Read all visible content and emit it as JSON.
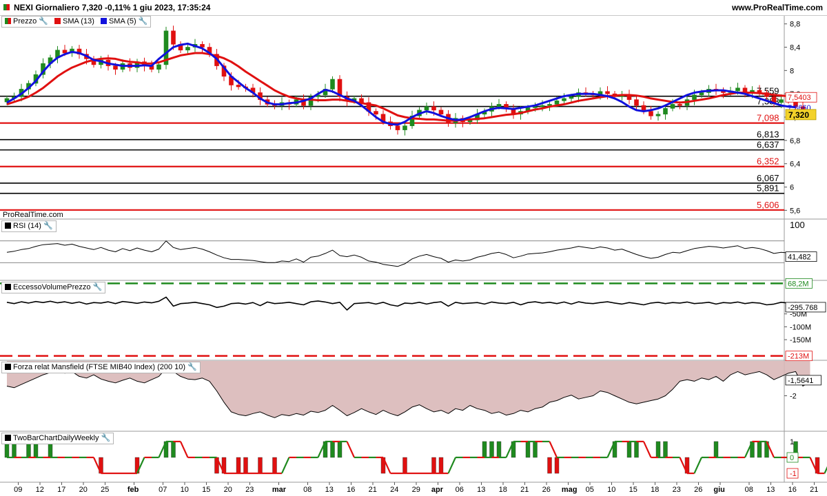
{
  "header": {
    "title": "NEXI Giornaliero 7,320 -0,11% 1 giu 2023, 17:35:24",
    "site": "www.ProRealTime.com",
    "watermark": "ProRealTime.com"
  },
  "colors": {
    "up": "#1f8a1f",
    "down": "#e01010",
    "sma13": "#e01010",
    "sma5": "#1111dd",
    "support": "#e01010",
    "resistance": "#000000",
    "mansfield_fill": "#d9b8b8",
    "mansfield_line": "#7a3030",
    "tick_box": "#f3d22a"
  },
  "icons": {
    "wrench": "wrench-icon"
  },
  "legends": {
    "price": "Prezzo",
    "sma13": "SMA (13)",
    "sma5": "SMA (5)",
    "rsi": "RSI (14)",
    "volume": "EccessoVolumePrezzo",
    "mansfield": "Forza relat Mansfield (FTSE MIB40 Index) (200 10)",
    "twobar": "TwoBarChartDailyWeekly"
  },
  "chart_data": [
    {
      "type": "candlestick",
      "panel": "price",
      "ylim": [
        5.45,
        8.95
      ],
      "yticks": [
        "8,8",
        "8,4",
        "8",
        "7,6",
        "7,2",
        "6,8",
        "6,4",
        "6",
        "5,6"
      ],
      "ytick_values": [
        8.8,
        8.4,
        8.0,
        7.6,
        7.2,
        6.8,
        6.4,
        6.0,
        5.6
      ],
      "levels": [
        {
          "value": 7.559,
          "label": "7,559",
          "color": "#000000"
        },
        {
          "value": 7.383,
          "label": "7,383",
          "color": "#000000"
        },
        {
          "value": 7.098,
          "label": "7,098",
          "color": "#e01010"
        },
        {
          "value": 6.813,
          "label": "6,813",
          "color": "#000000"
        },
        {
          "value": 6.637,
          "label": "6,637",
          "color": "#000000"
        },
        {
          "value": 6.352,
          "label": "6,352",
          "color": "#e01010"
        },
        {
          "value": 6.067,
          "label": "6,067",
          "color": "#000000"
        },
        {
          "value": 5.891,
          "label": "5,891",
          "color": "#000000"
        },
        {
          "value": 5.606,
          "label": "5,606",
          "color": "#e01010"
        }
      ],
      "current_labels": [
        {
          "value": 7.5403,
          "label": "7,5403",
          "color": "#e01010"
        },
        {
          "value": 7.366,
          "label": "7,3660",
          "color": "#1111dd"
        },
        {
          "value": 7.32,
          "label": "7,320",
          "color": "#000000"
        }
      ],
      "closes": [
        7.52,
        7.55,
        7.68,
        7.78,
        7.93,
        8.12,
        8.22,
        8.35,
        8.3,
        8.37,
        8.28,
        8.2,
        8.1,
        8.18,
        8.08,
        8.02,
        8.12,
        8.05,
        8.15,
        8.08,
        8.02,
        8.1,
        8.68,
        8.45,
        8.35,
        8.4,
        8.45,
        8.4,
        8.28,
        8.08,
        7.9,
        7.75,
        7.72,
        7.7,
        7.62,
        7.5,
        7.42,
        7.4,
        7.45,
        7.42,
        7.5,
        7.4,
        7.55,
        7.58,
        7.68,
        7.85,
        7.55,
        7.48,
        7.52,
        7.45,
        7.3,
        7.25,
        7.12,
        7.05,
        6.98,
        7.05,
        7.22,
        7.32,
        7.38,
        7.32,
        7.25,
        7.1,
        7.18,
        7.12,
        7.15,
        7.25,
        7.3,
        7.38,
        7.42,
        7.35,
        7.25,
        7.3,
        7.36,
        7.38,
        7.4,
        7.42,
        7.48,
        7.52,
        7.55,
        7.62,
        7.6,
        7.58,
        7.64,
        7.6,
        7.55,
        7.58,
        7.5,
        7.4,
        7.3,
        7.22,
        7.25,
        7.35,
        7.42,
        7.4,
        7.5,
        7.58,
        7.62,
        7.68,
        7.66,
        7.62,
        7.65,
        7.7,
        7.62,
        7.66,
        7.62,
        7.55,
        7.45,
        7.5,
        7.48,
        7.38,
        7.25,
        7.32
      ],
      "sma13": [
        7.42,
        7.46,
        7.5,
        7.55,
        7.62,
        7.7,
        7.8,
        7.9,
        7.98,
        8.05,
        8.1,
        8.15,
        8.18,
        8.2,
        8.21,
        8.2,
        8.17,
        8.15,
        8.14,
        8.12,
        8.12,
        8.14,
        8.18,
        8.22,
        8.26,
        8.28,
        8.3,
        8.3,
        8.28,
        8.25,
        8.21,
        8.15,
        8.07,
        7.98,
        7.9,
        7.82,
        7.74,
        7.66,
        7.6,
        7.55,
        7.52,
        7.5,
        7.5,
        7.49,
        7.49,
        7.5,
        7.5,
        7.48,
        7.46,
        7.44,
        7.42,
        7.4,
        7.35,
        7.29,
        7.23,
        7.2,
        7.18,
        7.17,
        7.16,
        7.16,
        7.15,
        7.14,
        7.14,
        7.15,
        7.16,
        7.17,
        7.18,
        7.2,
        7.22,
        7.24,
        7.25,
        7.27,
        7.3,
        7.33,
        7.35,
        7.38,
        7.4,
        7.42,
        7.45,
        7.48,
        7.5,
        7.52,
        7.54,
        7.56,
        7.57,
        7.58,
        7.58,
        7.57,
        7.55,
        7.52,
        7.5,
        7.48,
        7.46,
        7.45,
        7.46,
        7.48,
        7.5,
        7.52,
        7.55,
        7.58,
        7.6,
        7.62,
        7.62,
        7.62,
        7.61,
        7.6,
        7.58,
        7.57,
        7.56,
        7.55,
        7.54,
        7.54
      ],
      "sma5": [
        7.45,
        7.52,
        7.6,
        7.7,
        7.82,
        7.98,
        8.12,
        8.22,
        8.28,
        8.32,
        8.3,
        8.25,
        8.18,
        8.16,
        8.12,
        8.1,
        8.08,
        8.08,
        8.08,
        8.09,
        8.08,
        8.2,
        8.3,
        8.4,
        8.44,
        8.46,
        8.42,
        8.38,
        8.3,
        8.2,
        8.05,
        7.9,
        7.8,
        7.7,
        7.62,
        7.52,
        7.45,
        7.42,
        7.42,
        7.44,
        7.45,
        7.48,
        7.52,
        7.6,
        7.67,
        7.64,
        7.58,
        7.52,
        7.48,
        7.4,
        7.3,
        7.2,
        7.12,
        7.08,
        7.07,
        7.12,
        7.2,
        7.26,
        7.3,
        7.27,
        7.22,
        7.18,
        7.15,
        7.16,
        7.2,
        7.25,
        7.3,
        7.34,
        7.36,
        7.35,
        7.34,
        7.36,
        7.38,
        7.4,
        7.44,
        7.48,
        7.52,
        7.56,
        7.58,
        7.6,
        7.6,
        7.6,
        7.58,
        7.56,
        7.52,
        7.46,
        7.38,
        7.32,
        7.3,
        7.32,
        7.35,
        7.4,
        7.46,
        7.52,
        7.58,
        7.62,
        7.64,
        7.65,
        7.66,
        7.66,
        7.64,
        7.62,
        7.6,
        7.56,
        7.52,
        7.48,
        7.44,
        7.4,
        7.38,
        7.37
      ]
    },
    {
      "type": "line",
      "panel": "rsi",
      "ylim": [
        0,
        100
      ],
      "yticks": [
        "100"
      ],
      "reference_lines": [
        70,
        30
      ],
      "last_label": "41,482",
      "values": [
        49,
        51,
        54,
        56,
        60,
        63,
        64,
        65,
        62,
        64,
        60,
        57,
        54,
        58,
        53,
        50,
        56,
        52,
        57,
        53,
        50,
        55,
        70,
        58,
        54,
        56,
        58,
        55,
        50,
        44,
        39,
        36,
        36,
        35,
        34,
        32,
        30,
        30,
        33,
        32,
        37,
        31,
        40,
        42,
        47,
        53,
        43,
        41,
        44,
        40,
        33,
        31,
        27,
        25,
        23,
        28,
        37,
        42,
        45,
        41,
        38,
        31,
        35,
        33,
        35,
        40,
        43,
        47,
        49,
        45,
        39,
        42,
        46,
        47,
        48,
        50,
        53,
        55,
        57,
        60,
        58,
        56,
        59,
        57,
        53,
        55,
        50,
        45,
        41,
        38,
        40,
        45,
        49,
        48,
        52,
        56,
        58,
        60,
        59,
        57,
        59,
        61,
        56,
        58,
        56,
        52,
        47,
        49,
        48,
        43,
        38,
        41
      ]
    },
    {
      "type": "line",
      "panel": "volume_excess",
      "ylim": [
        -230,
        80
      ],
      "yticks": [
        "-50M",
        "-100M",
        "-150M"
      ],
      "ytick_values": [
        -50,
        -100,
        -150
      ],
      "upper_label": "68,2M",
      "upper_value": 68.2,
      "lower_label": "-213M",
      "lower_value": -213,
      "last_label": "-295.768",
      "values": [
        -5,
        -10,
        -3,
        -8,
        -2,
        -6,
        -1,
        -7,
        -3,
        -9,
        -4,
        -12,
        -6,
        -8,
        -3,
        -10,
        -2,
        -5,
        -9,
        -4,
        -7,
        -1,
        15,
        -20,
        -10,
        -8,
        -5,
        -10,
        -15,
        -25,
        -20,
        -10,
        -8,
        -12,
        -6,
        -18,
        -4,
        -10,
        -8,
        -5,
        -10,
        -15,
        -3,
        0,
        -4,
        -10,
        -5,
        -35,
        -10,
        -8,
        -6,
        -12,
        -5,
        -15,
        -20,
        -8,
        -10,
        -5,
        -12,
        -6,
        -3,
        -20,
        -5,
        -10,
        -8,
        -6,
        -12,
        -4,
        -8,
        -10,
        -5,
        -15,
        -6,
        -3,
        -8,
        -5,
        -10,
        -4,
        -12,
        -3,
        -8,
        -10,
        -6,
        -3,
        -8,
        -12,
        -6,
        -10,
        -15,
        -8,
        -5,
        -10,
        -6,
        -8,
        -4,
        -10,
        -8,
        -5,
        -12,
        -6,
        -8,
        -4,
        -10,
        -6,
        -8,
        -15,
        -12,
        -5,
        -8,
        -6,
        -10,
        -8
      ]
    },
    {
      "type": "area",
      "panel": "mansfield",
      "ylim": [
        -3.1,
        -0.9
      ],
      "yticks": [
        "-2"
      ],
      "ytick_values": [
        -2
      ],
      "last_label": "-1,5641",
      "values": [
        -1.7,
        -1.75,
        -1.65,
        -1.55,
        -1.45,
        -1.35,
        -1.28,
        -1.22,
        -1.3,
        -1.25,
        -1.4,
        -1.45,
        -1.35,
        -1.48,
        -1.55,
        -1.6,
        -1.52,
        -1.45,
        -1.55,
        -1.6,
        -1.5,
        -1.4,
        -1.15,
        -1.25,
        -1.4,
        -1.48,
        -1.5,
        -1.45,
        -1.55,
        -1.85,
        -2.2,
        -2.5,
        -2.58,
        -2.62,
        -2.55,
        -2.5,
        -2.6,
        -2.68,
        -2.58,
        -2.62,
        -2.55,
        -2.6,
        -2.48,
        -2.52,
        -2.45,
        -2.3,
        -2.45,
        -2.62,
        -2.52,
        -2.4,
        -2.5,
        -2.58,
        -2.45,
        -2.55,
        -2.62,
        -2.5,
        -2.35,
        -2.28,
        -2.4,
        -2.5,
        -2.45,
        -2.55,
        -2.4,
        -2.45,
        -2.3,
        -2.4,
        -2.45,
        -2.55,
        -2.5,
        -2.6,
        -2.55,
        -2.45,
        -2.5,
        -2.4,
        -2.35,
        -2.2,
        -2.15,
        -2.05,
        -1.98,
        -2.1,
        -2.05,
        -2.0,
        -1.85,
        -1.9,
        -2.0,
        -2.1,
        -2.2,
        -2.25,
        -2.2,
        -2.15,
        -2.1,
        -2.0,
        -1.8,
        -1.55,
        -1.5,
        -1.55,
        -1.45,
        -1.5,
        -1.4,
        -1.55,
        -1.35,
        -1.25,
        -1.35,
        -1.3,
        -1.25,
        -1.35,
        -1.5,
        -1.4,
        -1.3,
        -1.25,
        -1.7,
        -1.56
      ]
    },
    {
      "type": "bar",
      "panel": "twobar",
      "ylim": [
        -1.3,
        1.3
      ],
      "yticks": [
        "1",
        "0",
        "-1"
      ],
      "ytick_values": [
        1,
        0,
        -1
      ],
      "values": [
        1,
        1,
        0,
        1,
        1,
        0,
        1,
        0,
        0,
        0,
        0,
        0,
        0,
        -1,
        0,
        0,
        0,
        0,
        -1,
        0,
        0,
        0,
        1,
        1,
        0,
        0,
        0,
        0,
        0,
        -1,
        -1,
        0,
        -1,
        -1,
        0,
        -1,
        0,
        -1,
        0,
        0,
        0,
        0,
        0,
        0,
        1,
        1,
        1,
        0,
        0,
        0,
        0,
        0,
        -1,
        0,
        0,
        -1,
        0,
        0,
        0,
        -1,
        -1,
        0,
        0,
        0,
        0,
        0,
        1,
        1,
        1,
        0,
        1,
        0,
        1,
        1,
        0,
        -1,
        -1,
        0,
        0,
        0,
        0,
        0,
        0,
        0,
        1,
        0,
        1,
        1,
        0,
        0,
        1,
        1,
        0,
        0,
        -1,
        0,
        0,
        0,
        1,
        0,
        0,
        0,
        0,
        1,
        1,
        1,
        0,
        0,
        0,
        1,
        0,
        0,
        -1,
        0,
        0,
        0,
        0,
        0,
        1,
        0,
        -1,
        -1,
        0
      ],
      "line_values": [
        0,
        0,
        0,
        0,
        0,
        0,
        0,
        0,
        0,
        0,
        0,
        0,
        0,
        -1,
        -1,
        -1,
        -1,
        -1,
        -1,
        0,
        0,
        0,
        1,
        1,
        1,
        0,
        0,
        0,
        0,
        0,
        -1,
        -1,
        -1,
        -1,
        -1,
        -1,
        -1,
        -1,
        -1,
        0,
        0,
        0,
        0,
        0,
        1,
        1,
        1,
        1,
        0,
        0,
        0,
        0,
        0,
        -1,
        -1,
        -1,
        -1,
        -1,
        -1,
        -1,
        -1,
        -1,
        0,
        0,
        0,
        0,
        0,
        0,
        0,
        0,
        1,
        1,
        1,
        1,
        1,
        1,
        0,
        0,
        0,
        0,
        0,
        0,
        0,
        0,
        1,
        1,
        1,
        1,
        1,
        0,
        0,
        0,
        0,
        0,
        -1,
        -1,
        0,
        0,
        0,
        0,
        0,
        0,
        0,
        1,
        1,
        1,
        0,
        0,
        0,
        0,
        0,
        0,
        -1,
        -1,
        0,
        0,
        0,
        0,
        -1,
        -1,
        -1
      ]
    }
  ],
  "x_axis": {
    "ticks": [
      {
        "i": 1,
        "label": "09"
      },
      {
        "i": 4,
        "label": "12"
      },
      {
        "i": 7,
        "label": "17"
      },
      {
        "i": 10,
        "label": "20"
      },
      {
        "i": 13,
        "label": "25"
      },
      {
        "i": 17,
        "label": "feb",
        "bold": true
      },
      {
        "i": 21,
        "label": "07"
      },
      {
        "i": 24,
        "label": "10"
      },
      {
        "i": 27,
        "label": "15"
      },
      {
        "i": 30,
        "label": "20"
      },
      {
        "i": 33,
        "label": "23"
      },
      {
        "i": 37,
        "label": "mar",
        "bold": true
      },
      {
        "i": 41,
        "label": "08"
      },
      {
        "i": 44,
        "label": "13"
      },
      {
        "i": 47,
        "label": "16"
      },
      {
        "i": 50,
        "label": "21"
      },
      {
        "i": 53,
        "label": "24"
      },
      {
        "i": 56,
        "label": "29"
      },
      {
        "i": 59,
        "label": "apr",
        "bold": true
      },
      {
        "i": 62,
        "label": "06"
      },
      {
        "i": 65,
        "label": "13"
      },
      {
        "i": 68,
        "label": "18"
      },
      {
        "i": 71,
        "label": "21"
      },
      {
        "i": 74,
        "label": "26"
      },
      {
        "i": 77,
        "label": "mag",
        "bold": true
      },
      {
        "i": 80,
        "label": "05"
      },
      {
        "i": 83,
        "label": "10"
      },
      {
        "i": 86,
        "label": "15"
      },
      {
        "i": 89,
        "label": "18"
      },
      {
        "i": 92,
        "label": "23"
      },
      {
        "i": 95,
        "label": "26"
      },
      {
        "i": 98,
        "label": "giu",
        "bold": true
      },
      {
        "i": 102,
        "label": "08"
      },
      {
        "i": 105,
        "label": "13"
      },
      {
        "i": 108,
        "label": "16"
      },
      {
        "i": 111,
        "label": "21"
      }
    ]
  }
}
